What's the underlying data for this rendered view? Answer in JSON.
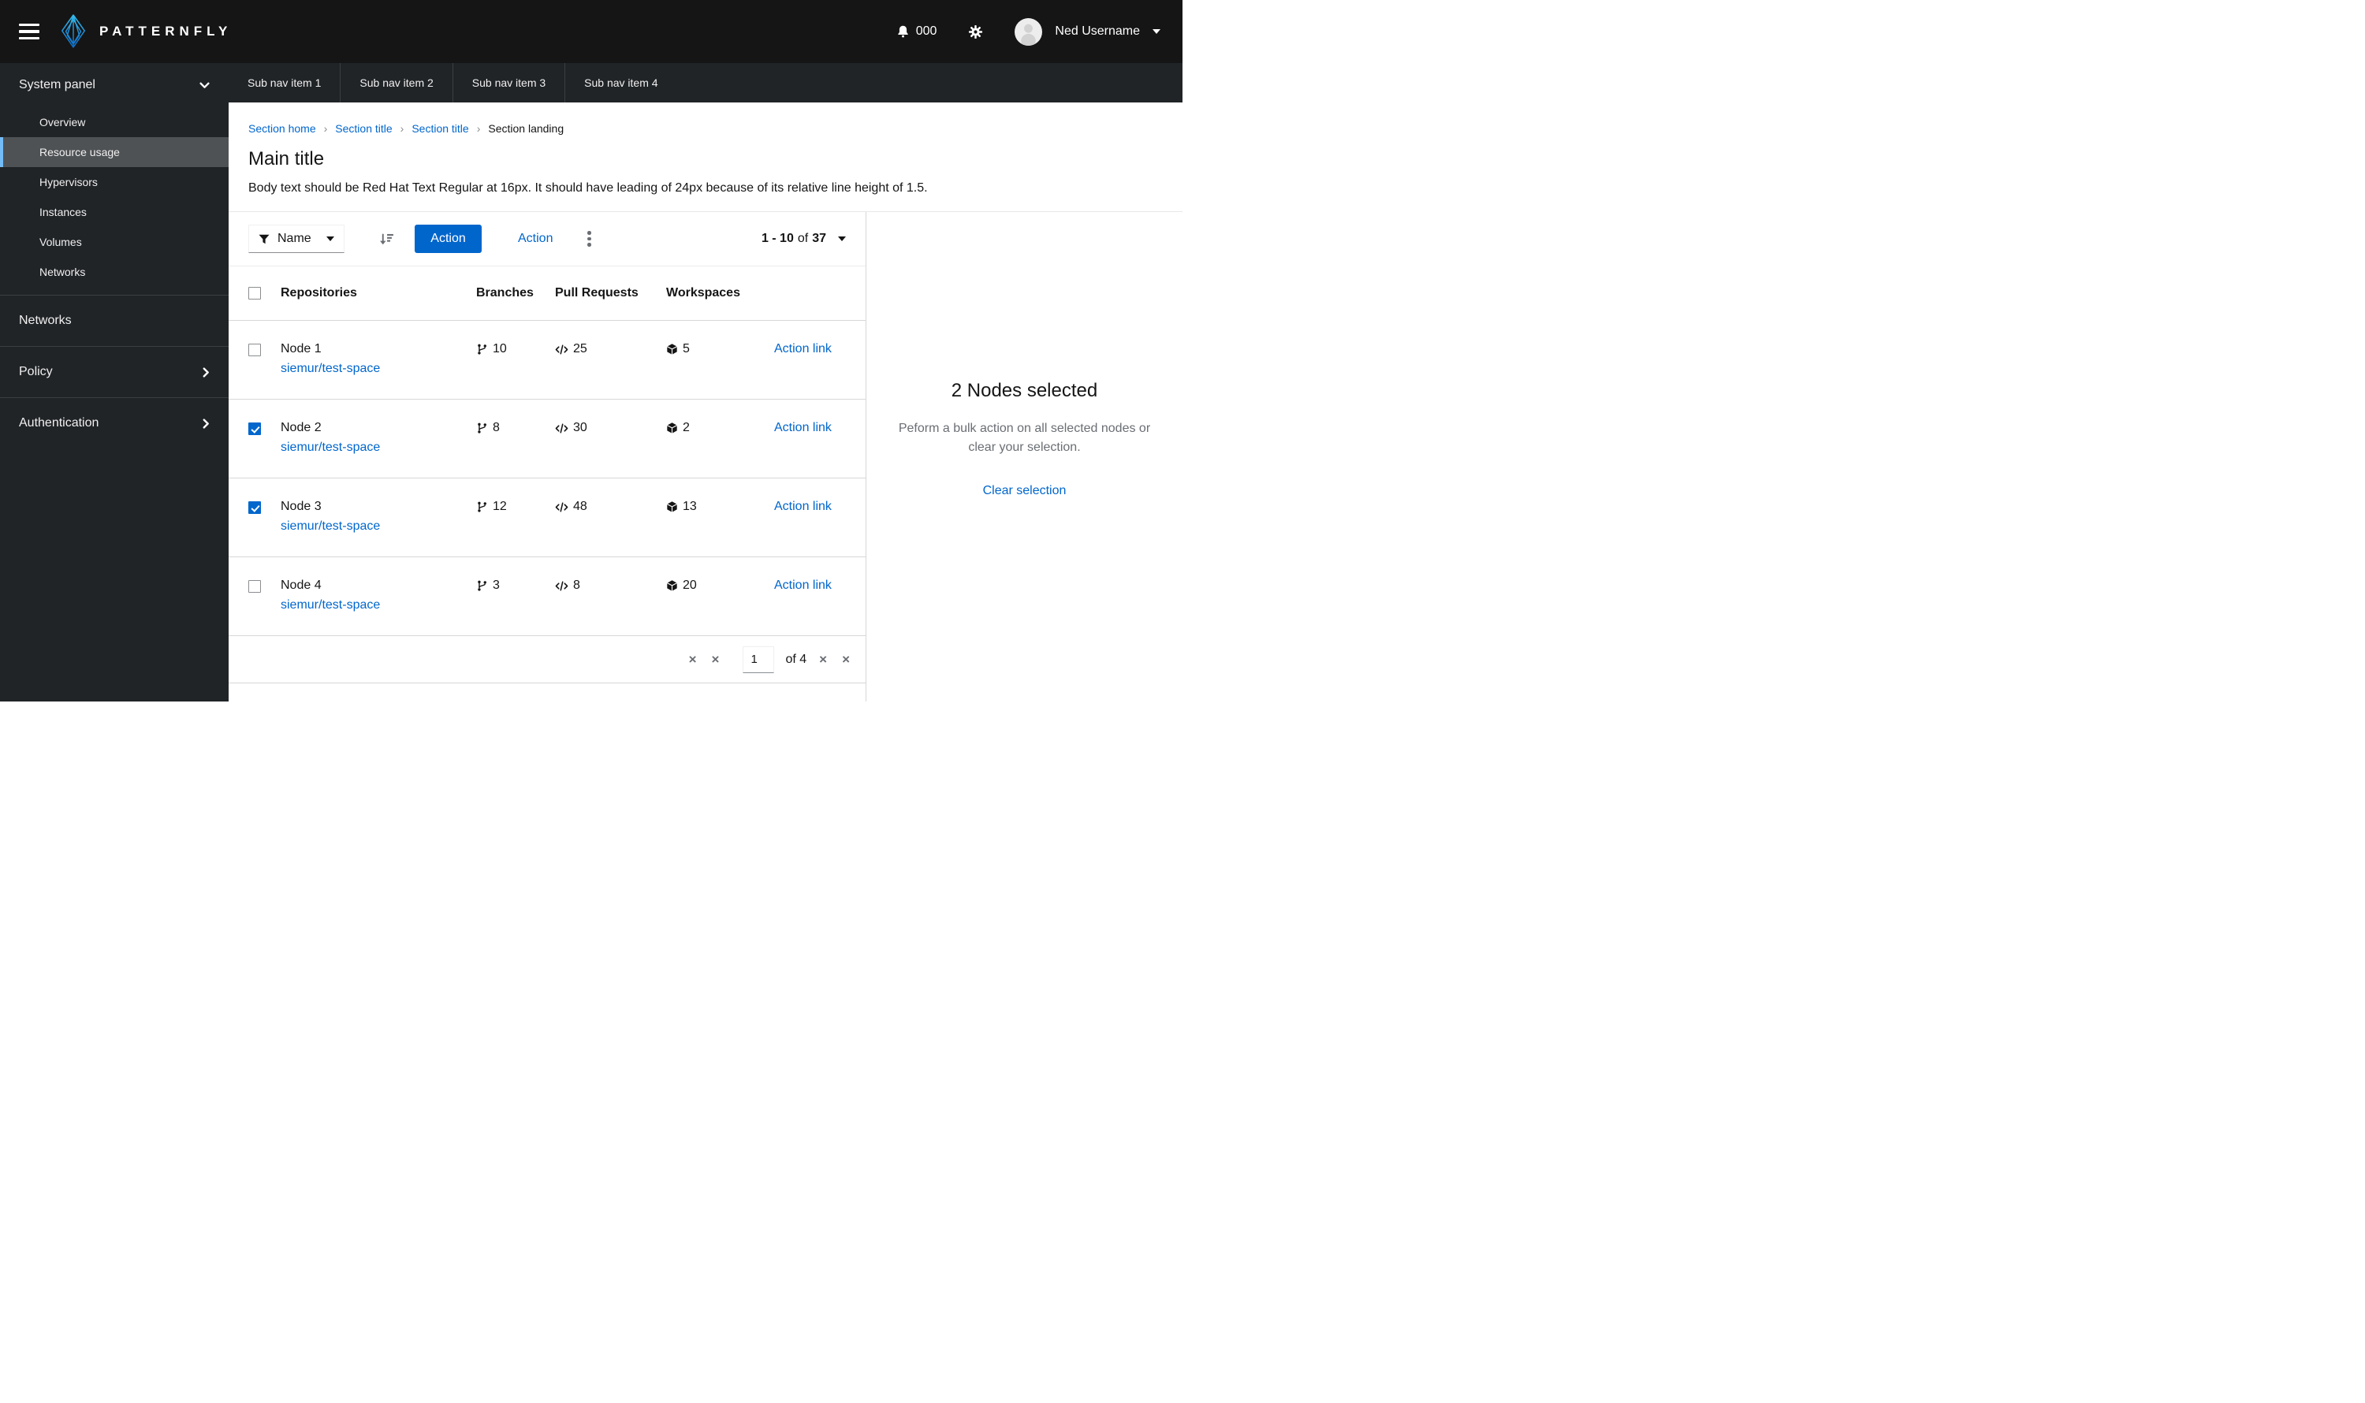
{
  "colors": {
    "accent": "#0066cc",
    "masthead_bg": "#151515",
    "sidebar_bg": "#212427",
    "nav_selected_bg": "#4f5255",
    "nav_selected_accent": "#73bcf7",
    "border": "#d7d7d7",
    "muted": "#6a6e73"
  },
  "masthead": {
    "brand": "PATTERNFLY",
    "notification_count": "000",
    "username": "Ned Username"
  },
  "sidebar": {
    "sections": [
      {
        "type": "expanded",
        "label": "System panel",
        "items": [
          {
            "label": "Overview",
            "selected": false
          },
          {
            "label": "Resource usage",
            "selected": true
          },
          {
            "label": "Hypervisors",
            "selected": false
          },
          {
            "label": "Instances",
            "selected": false
          },
          {
            "label": "Volumes",
            "selected": false
          },
          {
            "label": "Networks",
            "selected": false
          }
        ]
      },
      {
        "type": "plain",
        "label": "Networks"
      },
      {
        "type": "expandable",
        "label": "Policy"
      },
      {
        "type": "expandable",
        "label": "Authentication"
      }
    ]
  },
  "subnav": {
    "items": [
      "Sub nav item 1",
      "Sub nav item 2",
      "Sub nav item 3",
      "Sub nav item 4"
    ]
  },
  "breadcrumb": {
    "separator": "›",
    "items": [
      {
        "label": "Section home",
        "current": false
      },
      {
        "label": "Section title",
        "current": false
      },
      {
        "label": "Section title",
        "current": false
      },
      {
        "label": "Section landing",
        "current": true
      }
    ]
  },
  "page": {
    "title": "Main title",
    "body": "Body text should be Red Hat Text Regular at 16px. It should have leading of 24px because of its relative line height of 1.5."
  },
  "toolbar": {
    "filter": {
      "label": "Name"
    },
    "primary_action": "Action",
    "link_action": "Action",
    "pagination": {
      "range": "1 - 10",
      "of_word": "of",
      "total": "37"
    }
  },
  "table": {
    "columns": [
      "Repositories",
      "Branches",
      "Pull Requests",
      "Workspaces"
    ],
    "rows": [
      {
        "name": "Node 1",
        "link": "siemur/test-space",
        "branches": "10",
        "pull_requests": "25",
        "workspaces": "5",
        "action": "Action link",
        "checked": false
      },
      {
        "name": "Node 2",
        "link": "siemur/test-space",
        "branches": "8",
        "pull_requests": "30",
        "workspaces": "2",
        "action": "Action link",
        "checked": true
      },
      {
        "name": "Node 3",
        "link": "siemur/test-space",
        "branches": "12",
        "pull_requests": "48",
        "workspaces": "13",
        "action": "Action link",
        "checked": true
      },
      {
        "name": "Node 4",
        "link": "siemur/test-space",
        "branches": "3",
        "pull_requests": "8",
        "workspaces": "20",
        "action": "Action link",
        "checked": false
      }
    ]
  },
  "footer_pagination": {
    "first": "×",
    "prev": "×",
    "page": "1",
    "of_label": "of 4",
    "next": "×",
    "last": "×"
  },
  "drawer": {
    "title": "2 Nodes selected",
    "description": "Peform a bulk action on all selected nodes or clear your selection.",
    "action": "Clear selection"
  }
}
